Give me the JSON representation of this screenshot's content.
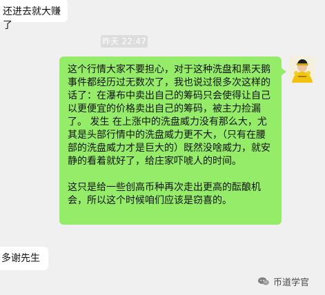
{
  "chat": {
    "top_partial_message": "还进去就大赚了",
    "timestamp": "昨天 22:47",
    "main_message": "这个行情大家不要担心，对于这种洗盘和黑天鹅事件都经历过无数次了，我也说过很多次这样的话了：在瀑布中卖出自己的筹码只会使得让自己以更便宜的价格卖出自己的筹码，被主力捡漏了。 发生 在上涨中的洗盘威力没有那么大，尤其是头部行情中的洗盘威力更不大，（只有在腰部的洗盘威力才是巨大的）既然没啥威力，就安静的看着就好了，给庄家吓唬人的时间。\n\n这只是给一些创高币种再次走出更高的酝酿机会，所以这个时候咱们应该是窃喜的。",
    "bottom_partial_message": "多谢先生"
  },
  "watermark": {
    "icon": "wechat-icon",
    "text": "币道学官"
  },
  "colors": {
    "background": "#f0f0f0",
    "incoming_bubble": "#ffffff",
    "outgoing_bubble": "#95ec69",
    "timestamp_bg": "#dcdcdc"
  }
}
